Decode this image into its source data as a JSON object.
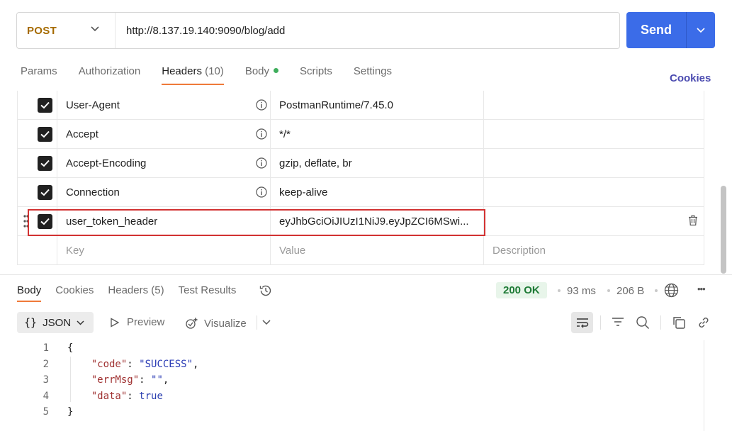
{
  "request": {
    "method": "POST",
    "url": "http://8.137.19.140:9090/blog/add",
    "send_label": "Send"
  },
  "req_tabs": [
    {
      "label": "Params"
    },
    {
      "label": "Authorization"
    },
    {
      "label": "Headers",
      "count": "(10)"
    },
    {
      "label": "Body"
    },
    {
      "label": "Scripts"
    },
    {
      "label": "Settings"
    }
  ],
  "cookies_label": "Cookies",
  "headers": [
    {
      "key": "User-Agent",
      "value": "PostmanRuntime/7.45.0"
    },
    {
      "key": "Accept",
      "value": "*/*"
    },
    {
      "key": "Accept-Encoding",
      "value": "gzip, deflate, br"
    },
    {
      "key": "Connection",
      "value": "keep-alive"
    },
    {
      "key": "user_token_header",
      "value": "eyJhbGciOiJIUzI1NiJ9.eyJpZCI6MSwi..."
    }
  ],
  "placeholders": {
    "key": "Key",
    "value": "Value",
    "description": "Description"
  },
  "resp_tabs": [
    {
      "label": "Body"
    },
    {
      "label": "Cookies"
    },
    {
      "label": "Headers",
      "count": "(5)"
    },
    {
      "label": "Test Results"
    }
  ],
  "response": {
    "status": "200 OK",
    "time": "93 ms",
    "size": "206 B",
    "more": "•••"
  },
  "toolbar": {
    "format": "JSON",
    "preview": "Preview",
    "visualize": "Visualize"
  },
  "code_lines": [
    {
      "n": "1"
    },
    {
      "n": "2"
    },
    {
      "n": "3"
    },
    {
      "n": "4"
    },
    {
      "n": "5"
    }
  ],
  "json_body": {
    "open": "{",
    "code_key": "\"code\"",
    "code_val": "\"SUCCESS\"",
    "errmsg_key": "\"errMsg\"",
    "errmsg_val": "\"\"",
    "data_key": "\"data\"",
    "data_val": "true",
    "close": "}"
  },
  "colors": {
    "send": "#3b6ce8",
    "method": "#a56a00",
    "tab_underline": "#ef7a3a",
    "status_ok": "#1d7a35",
    "highlight": "#d23232"
  }
}
